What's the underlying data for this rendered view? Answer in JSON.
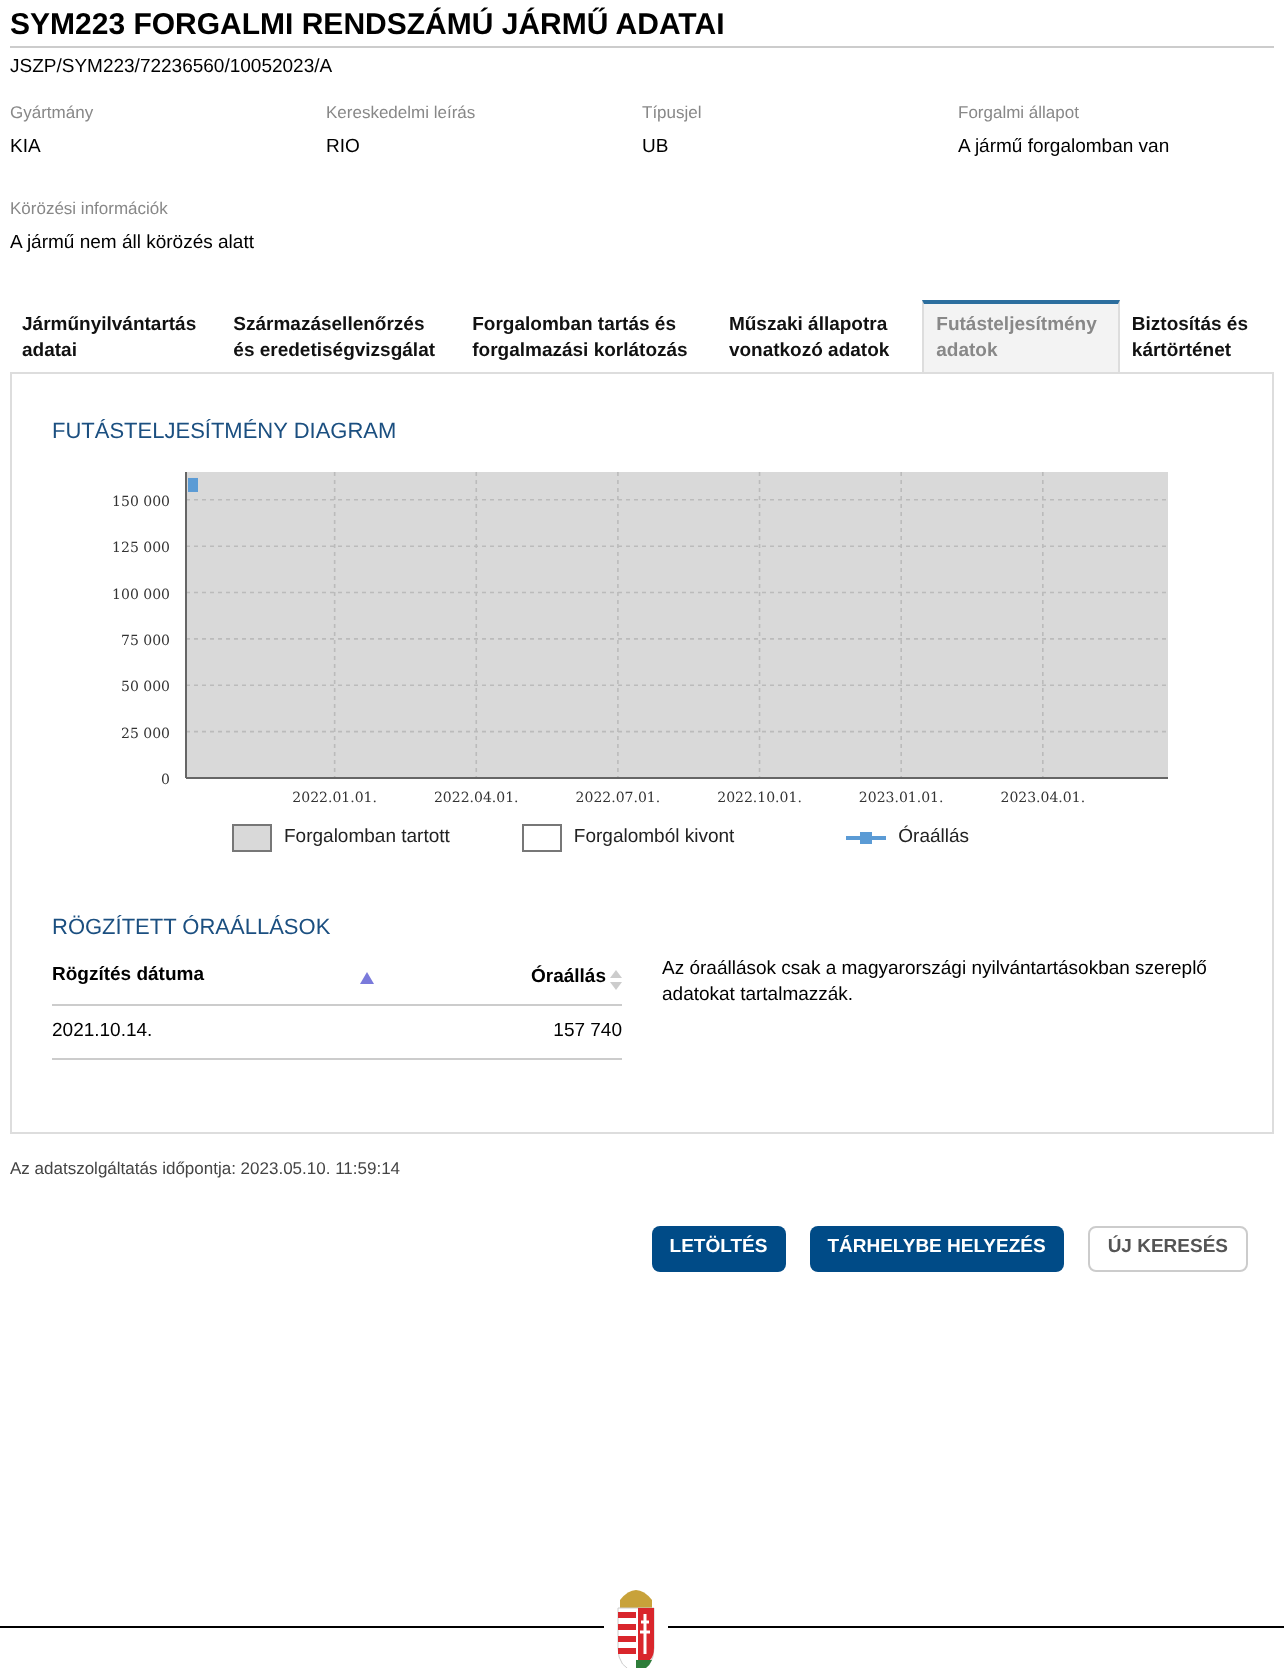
{
  "title": "SYM223 FORGALMI RENDSZÁMÚ JÁRMŰ ADATAI",
  "reference": "JSZP/SYM223/72236560/10052023/A",
  "fields": [
    {
      "label": "Gyártmány",
      "value": "KIA"
    },
    {
      "label": "Kereskedelmi leírás",
      "value": "RIO"
    },
    {
      "label": "Típusjel",
      "value": "UB"
    },
    {
      "label": "Forgalmi állapot",
      "value": "A jármű forgalomban van"
    }
  ],
  "wanted_info": {
    "label": "Körözési információk",
    "value": "A jármű nem áll körözés alatt"
  },
  "tabs": [
    {
      "label": "Járműnyilvántartás adatai",
      "selected": false
    },
    {
      "label": "Származásellenőrzés és eredetiségvizsgálat",
      "selected": false
    },
    {
      "label": "Forgalomban tartás és forgalmazási korlátozás",
      "selected": false
    },
    {
      "label": "Műszaki állapotra vonatkozó adatok",
      "selected": false
    },
    {
      "label": "Futásteljesítmény adatok",
      "selected": true
    },
    {
      "label": "Biztosítás és kártörténet",
      "selected": false
    }
  ],
  "diagram": {
    "heading": "FUTÁSTELJESÍTMÉNY DIAGRAM",
    "chart_data": {
      "type": "line",
      "grid": true,
      "categories": [
        null,
        null,
        null,
        "2022.01.01.",
        null,
        null,
        "2022.04.01.",
        null,
        null,
        "2022.07.01.",
        null,
        null,
        "2022.10.01.",
        null,
        null,
        "2023.01.01.",
        null,
        null,
        "2023.04.01.",
        null
      ],
      "ylim": [
        0,
        165000
      ],
      "yticks": [
        {
          "value": 0,
          "label": "0"
        },
        {
          "value": 25000,
          "label": "25 000"
        },
        {
          "value": 50000,
          "label": "50 000"
        },
        {
          "value": 75000,
          "label": "75 000"
        },
        {
          "value": 100000,
          "label": "100 000"
        },
        {
          "value": 125000,
          "label": "125 000"
        },
        {
          "value": 150000,
          "label": "150 000"
        }
      ],
      "series": [
        {
          "name": "Óraállás",
          "color": "#5b9bd5",
          "marker": "square",
          "values": [
            158000,
            null,
            null,
            null,
            null,
            null,
            null,
            null,
            null,
            null,
            null,
            null,
            null,
            null,
            null,
            null,
            null,
            null,
            null,
            null
          ]
        }
      ]
    },
    "legend": [
      {
        "label": "Forgalomban tartott",
        "kind": "filled"
      },
      {
        "label": "Forgalomból kivont",
        "kind": "empty"
      }
    ]
  },
  "readings": {
    "heading": "RÖGZÍTETT ÓRAÁLLÁSOK",
    "columns": [
      {
        "label": "Rögzítés dátuma",
        "sorted": true
      },
      {
        "label": "Óraállás",
        "sorted": false
      }
    ],
    "rows": [
      [
        "2021.10.14.",
        "157 740"
      ]
    ],
    "note": "Az óraállások csak a magyarországi nyilvántartásokban szereplő adatokat tartalmazzák."
  },
  "timestamp": "Az adatszolgáltatás időpontja: 2023.05.10. 11:59:14",
  "buttons": [
    {
      "label": "LETÖLTÉS",
      "kind": "primary"
    },
    {
      "label": "TÁRHELYBE HELYEZÉS",
      "kind": "primary"
    },
    {
      "label": "ÚJ KERESÉS",
      "kind": "secondary"
    }
  ]
}
